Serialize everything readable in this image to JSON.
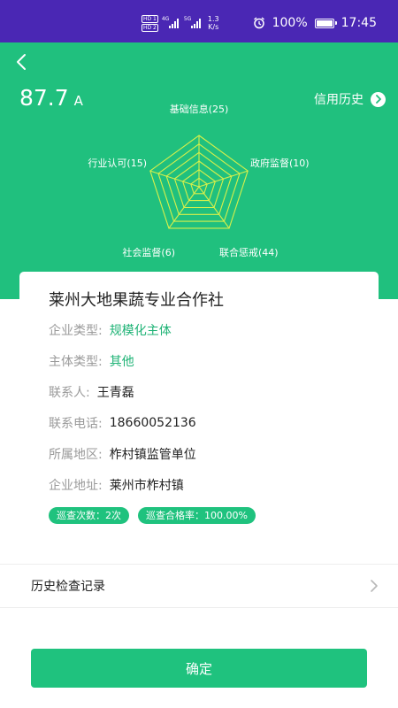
{
  "status_bar": {
    "hd1": "HD 1",
    "hd2": "HD 2",
    "net1": "4G",
    "net2": "5G",
    "speed_value": "1.3",
    "speed_unit": "K/s",
    "battery": "100%",
    "time": "17:45"
  },
  "header": {
    "score": "87.7",
    "grade": "A",
    "credit_history": "信用历史",
    "radar": {
      "labels": [
        "基础信息(25)",
        "政府监督(10)",
        "联合惩戒(44)",
        "社会监督(6)",
        "行业认可(15)"
      ]
    }
  },
  "card": {
    "company_name": "莱州大地果蔬专业合作社",
    "rows": [
      {
        "label": "企业类型:",
        "value": "规模化主体"
      },
      {
        "label": "主体类型:",
        "value": "其他"
      },
      {
        "label": "联系人:",
        "value": "王青磊"
      },
      {
        "label": "联系电话:",
        "value": "18660052136"
      },
      {
        "label": "所属地区:",
        "value": "柞村镇监管单位"
      },
      {
        "label": "企业地址:",
        "value": "莱州市柞村镇"
      }
    ],
    "badges": [
      "巡查次数：2次",
      "巡查合格率：100.00%"
    ]
  },
  "history": {
    "label": "历史检查记录"
  },
  "confirm": {
    "label": "确定"
  },
  "colors": {
    "header_green": "#20c07e",
    "accent_green": "#1fb376",
    "status_purple": "#4a27b4",
    "radar_line": "#d8f04a"
  }
}
